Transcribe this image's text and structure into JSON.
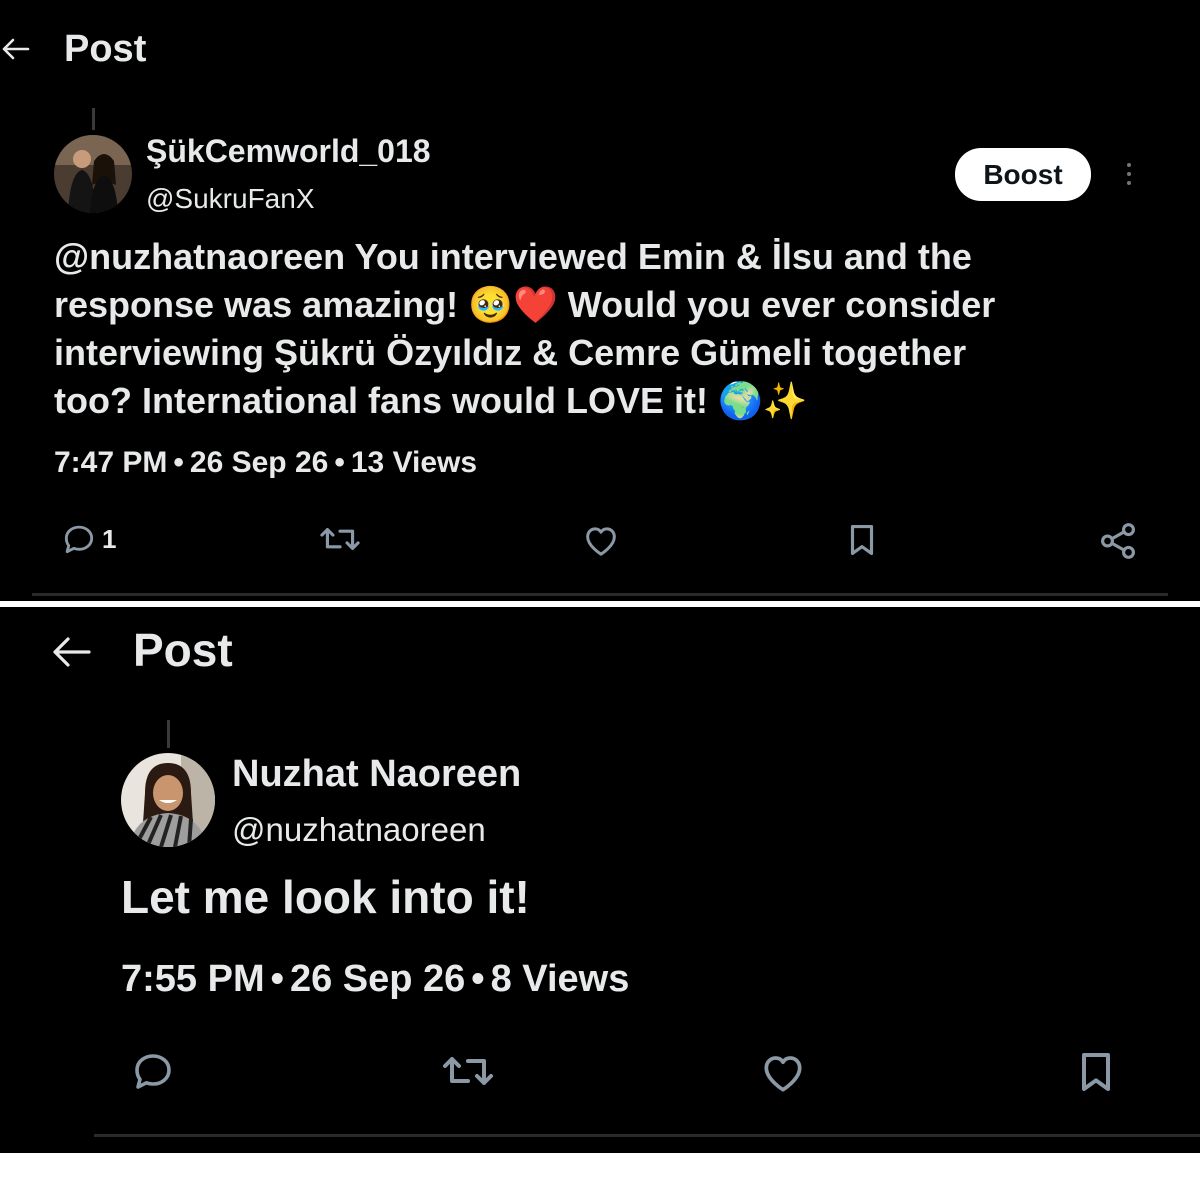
{
  "post1": {
    "header_title": "Post",
    "display_name": "ŞükCemworld_018",
    "handle": "@SukruFanX",
    "boost_label": "Boost",
    "text_line1": "@nuzhatnaoreen You interviewed Emin & İlsu and the",
    "text_line2_a": "response was amazing! ",
    "text_line2_emoji": "🥹❤️",
    "text_line2_b": " Would you ever consider",
    "text_line3": "interviewing Şükrü Özyıldız & Cemre Gümeli together",
    "text_line4_a": "too? International fans would LOVE it! ",
    "text_line4_emoji": "🌍✨",
    "time": "7:47 PM",
    "date": "26 Sep 26",
    "views": "13 Views",
    "reply_count": "1",
    "actions": [
      "reply-icon",
      "repost-icon",
      "like-icon",
      "bookmark-icon",
      "share-icon"
    ]
  },
  "post2": {
    "header_title": "Post",
    "display_name": "Nuzhat Naoreen",
    "handle": "@nuzhatnaoreen",
    "text": "Let me look into it!",
    "time": "7:55 PM",
    "date": "26 Sep 26",
    "views": "8 Views",
    "actions": [
      "reply-icon",
      "repost-icon",
      "like-icon",
      "bookmark-icon"
    ]
  },
  "colors": {
    "background": "#000000",
    "text": "#e7e9ea",
    "icon": "#8b98a5",
    "boost_bg": "#ffffff"
  }
}
